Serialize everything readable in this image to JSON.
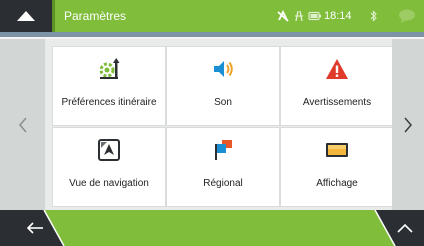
{
  "header": {
    "title": "Paramètres",
    "time": "18:14"
  },
  "tiles": [
    {
      "label": "Préférences itinéraire",
      "icon": "route-preferences-icon"
    },
    {
      "label": "Son",
      "icon": "speaker-icon"
    },
    {
      "label": "Avertissements",
      "icon": "warning-icon"
    },
    {
      "label": "Vue de navigation",
      "icon": "map-view-icon"
    },
    {
      "label": "Régional",
      "icon": "flags-icon"
    },
    {
      "label": "Affichage",
      "icon": "display-icon"
    }
  ],
  "colors": {
    "accent_green": "#7fbd3b",
    "dark_bar": "#2b2f33",
    "warning_red": "#e03a2a",
    "sound_blue": "#1b8fd3"
  }
}
